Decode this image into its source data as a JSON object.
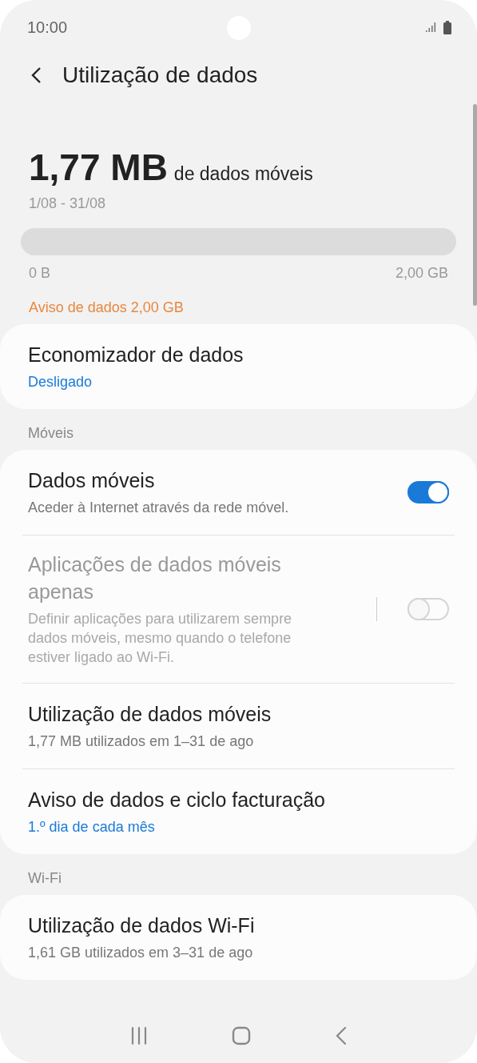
{
  "status_bar": {
    "time": "10:00"
  },
  "header": {
    "title": "Utilização de dados"
  },
  "usage": {
    "amount": "1,77 MB",
    "unit_label": "de dados móveis",
    "period": "1/08 - 31/08",
    "level": 0,
    "min_label": "0 B",
    "max_label": "2,00 GB",
    "warning": "Aviso de dados 2,00 GB"
  },
  "sections": [
    {
      "items": [
        {
          "kind": "plain",
          "title": "Economizador de dados",
          "subtitle": "Desligado",
          "accent": true,
          "disabled": false
        }
      ]
    },
    {
      "header": "Móveis",
      "items": [
        {
          "kind": "switch",
          "title": "Dados móveis",
          "subtitle": "Aceder à Internet através da rede móvel.",
          "on": true,
          "disabled": false
        },
        {
          "kind": "switch",
          "title": "Aplicações de dados móveis apenas",
          "subtitle": "Definir aplicações para utilizarem sempre dados móveis, mesmo quando o telefone estiver ligado ao Wi-Fi.",
          "on": false,
          "disabled": true
        },
        {
          "kind": "plain",
          "title": "Utilização de dados móveis",
          "subtitle": "1,77 MB utilizados em 1–31 de ago",
          "accent": false,
          "disabled": false
        },
        {
          "kind": "plain",
          "title": "Aviso de dados e ciclo facturação",
          "subtitle": "1.º dia de cada mês",
          "accent": true,
          "disabled": false
        }
      ]
    },
    {
      "header": "Wi-Fi",
      "items": [
        {
          "kind": "plain",
          "title": "Utilização de dados Wi-Fi",
          "subtitle": "1,61 GB utilizados em 3–31 de ago",
          "accent": false,
          "disabled": false
        }
      ]
    }
  ]
}
